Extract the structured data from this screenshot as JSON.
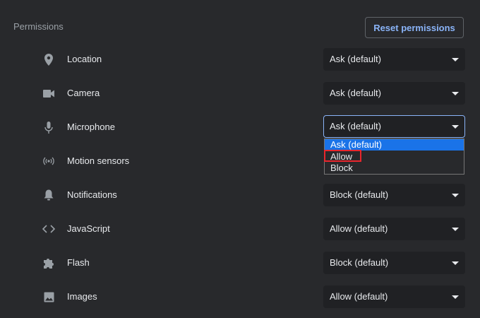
{
  "section": {
    "title": "Permissions"
  },
  "reset_button": {
    "label": "Reset permissions"
  },
  "permissions": [
    {
      "name": "location",
      "label": "Location",
      "icon": "location-pin-icon",
      "value": "Ask (default)"
    },
    {
      "name": "camera",
      "label": "Camera",
      "icon": "camera-icon",
      "value": "Ask (default)"
    },
    {
      "name": "microphone",
      "label": "Microphone",
      "icon": "microphone-icon",
      "value": "Ask (default)",
      "focused": true
    },
    {
      "name": "motion-sensors",
      "label": "Motion sensors",
      "icon": "sensors-icon",
      "value": ""
    },
    {
      "name": "notifications",
      "label": "Notifications",
      "icon": "bell-icon",
      "value": "Block (default)"
    },
    {
      "name": "javascript",
      "label": "JavaScript",
      "icon": "code-brackets-icon",
      "value": "Allow (default)"
    },
    {
      "name": "flash",
      "label": "Flash",
      "icon": "puzzle-piece-icon",
      "value": "Block (default)"
    },
    {
      "name": "images",
      "label": "Images",
      "icon": "image-icon",
      "value": "Allow (default)"
    }
  ],
  "microphone_dropdown": {
    "options": [
      "Ask (default)",
      "Allow",
      "Block"
    ],
    "selected": "Ask (default)",
    "annotated": "Allow"
  },
  "colors": {
    "background": "#28292c",
    "accent": "#8ab4f8",
    "selection": "#1a73e8",
    "annotation": "#e8262d"
  }
}
